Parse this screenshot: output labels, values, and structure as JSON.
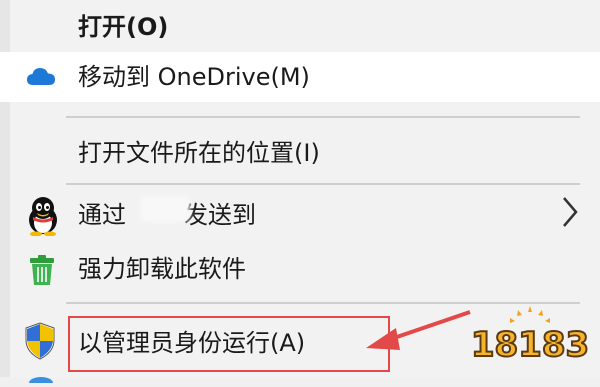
{
  "menu": {
    "items": [
      {
        "label": "打开(O)"
      },
      {
        "label": "移动到 OneDrive(M)"
      },
      {
        "label": "打开文件所在的位置(I)"
      },
      {
        "label": "通过",
        "label_tail": "发送到"
      },
      {
        "label": "强力卸载此软件"
      },
      {
        "label": "以管理员身份运行(A)"
      }
    ]
  },
  "watermark": {
    "text": "18183"
  },
  "icons": {
    "onedrive": "cloud-icon",
    "qq": "qq-penguin-icon",
    "uninstall": "trash-icon",
    "admin": "uac-shield-icon",
    "submenu": "chevron-right-icon"
  },
  "colors": {
    "highlight": "#e24a4a",
    "onedrive_blue": "#1e78d6",
    "trash_green": "#2f9e3a"
  }
}
